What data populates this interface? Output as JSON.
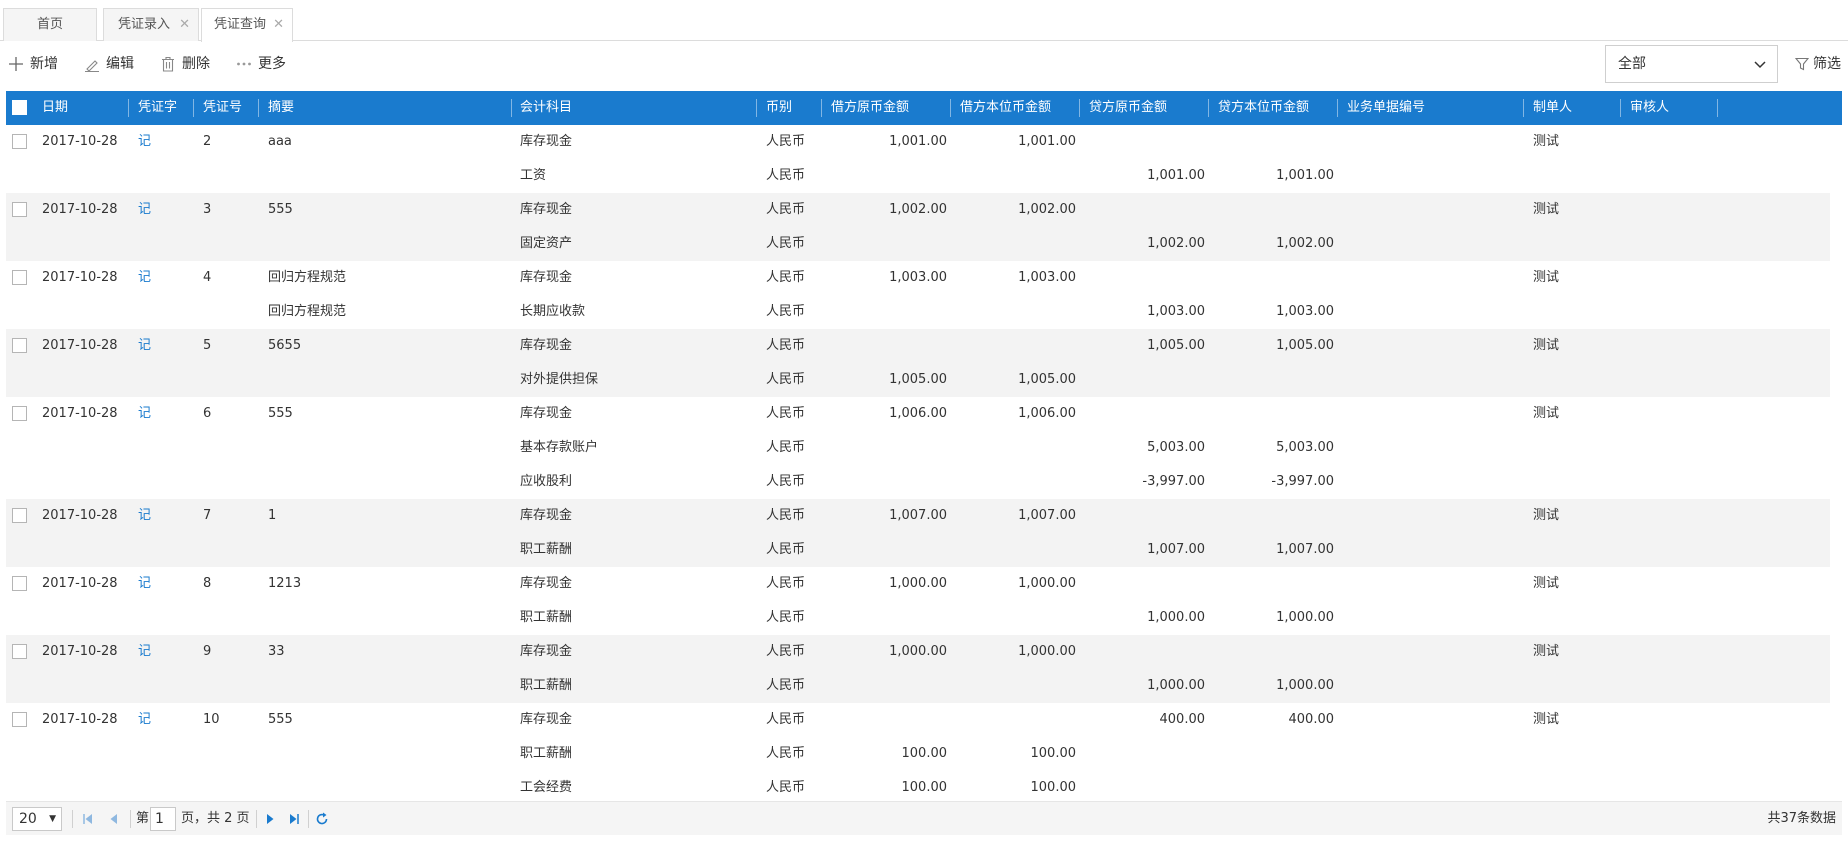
{
  "tabs": [
    {
      "label": "首页",
      "closable": false
    },
    {
      "label": "凭证录入",
      "closable": true
    },
    {
      "label": "凭证查询",
      "closable": true,
      "active": true
    }
  ],
  "toolbar": {
    "add_label": "新增",
    "edit_label": "编辑",
    "delete_label": "删除",
    "more_label": "更多",
    "filter_select_value": "全部",
    "filter_label": "筛选"
  },
  "table": {
    "headers": {
      "date": "日期",
      "voucher_word": "凭证字",
      "voucher_no": "凭证号",
      "summary": "摘要",
      "account": "会计科目",
      "currency": "币别",
      "debit_orig": "借方原币金额",
      "debit_local": "借方本位币金额",
      "credit_orig": "贷方原币金额",
      "credit_local": "贷方本位币金额",
      "biz_no": "业务单据编号",
      "maker": "制单人",
      "reviewer": "审核人"
    },
    "vouchers": [
      {
        "date": "2017-10-28",
        "word": "记",
        "no": "2",
        "maker": "测试",
        "entries": [
          {
            "summary": "aaa",
            "account": "库存现金",
            "currency": "人民币",
            "debit_orig": "1,001.00",
            "debit_local": "1,001.00",
            "credit_orig": "",
            "credit_local": ""
          },
          {
            "summary": "",
            "account": "工资",
            "currency": "人民币",
            "debit_orig": "",
            "debit_local": "",
            "credit_orig": "1,001.00",
            "credit_local": "1,001.00"
          }
        ]
      },
      {
        "date": "2017-10-28",
        "word": "记",
        "no": "3",
        "maker": "测试",
        "entries": [
          {
            "summary": "555",
            "account": "库存现金",
            "currency": "人民币",
            "debit_orig": "1,002.00",
            "debit_local": "1,002.00",
            "credit_orig": "",
            "credit_local": ""
          },
          {
            "summary": "",
            "account": "固定资产",
            "currency": "人民币",
            "debit_orig": "",
            "debit_local": "",
            "credit_orig": "1,002.00",
            "credit_local": "1,002.00"
          }
        ]
      },
      {
        "date": "2017-10-28",
        "word": "记",
        "no": "4",
        "maker": "测试",
        "entries": [
          {
            "summary": "回归方程规范",
            "account": "库存现金",
            "currency": "人民币",
            "debit_orig": "1,003.00",
            "debit_local": "1,003.00",
            "credit_orig": "",
            "credit_local": ""
          },
          {
            "summary": "回归方程规范",
            "account": "长期应收款",
            "currency": "人民币",
            "debit_orig": "",
            "debit_local": "",
            "credit_orig": "1,003.00",
            "credit_local": "1,003.00"
          }
        ]
      },
      {
        "date": "2017-10-28",
        "word": "记",
        "no": "5",
        "maker": "测试",
        "entries": [
          {
            "summary": "5655",
            "account": "库存现金",
            "currency": "人民币",
            "debit_orig": "",
            "debit_local": "",
            "credit_orig": "1,005.00",
            "credit_local": "1,005.00"
          },
          {
            "summary": "",
            "account": "对外提供担保",
            "currency": "人民币",
            "debit_orig": "1,005.00",
            "debit_local": "1,005.00",
            "credit_orig": "",
            "credit_local": ""
          }
        ]
      },
      {
        "date": "2017-10-28",
        "word": "记",
        "no": "6",
        "maker": "测试",
        "entries": [
          {
            "summary": "555",
            "account": "库存现金",
            "currency": "人民币",
            "debit_orig": "1,006.00",
            "debit_local": "1,006.00",
            "credit_orig": "",
            "credit_local": ""
          },
          {
            "summary": "",
            "account": "基本存款账户",
            "currency": "人民币",
            "debit_orig": "",
            "debit_local": "",
            "credit_orig": "5,003.00",
            "credit_local": "5,003.00"
          },
          {
            "summary": "",
            "account": "应收股利",
            "currency": "人民币",
            "debit_orig": "",
            "debit_local": "",
            "credit_orig": "-3,997.00",
            "credit_local": "-3,997.00"
          }
        ]
      },
      {
        "date": "2017-10-28",
        "word": "记",
        "no": "7",
        "maker": "测试",
        "entries": [
          {
            "summary": "1",
            "account": "库存现金",
            "currency": "人民币",
            "debit_orig": "1,007.00",
            "debit_local": "1,007.00",
            "credit_orig": "",
            "credit_local": ""
          },
          {
            "summary": "",
            "account": "职工薪酬",
            "currency": "人民币",
            "debit_orig": "",
            "debit_local": "",
            "credit_orig": "1,007.00",
            "credit_local": "1,007.00"
          }
        ]
      },
      {
        "date": "2017-10-28",
        "word": "记",
        "no": "8",
        "maker": "测试",
        "entries": [
          {
            "summary": "1213",
            "account": "库存现金",
            "currency": "人民币",
            "debit_orig": "1,000.00",
            "debit_local": "1,000.00",
            "credit_orig": "",
            "credit_local": ""
          },
          {
            "summary": "",
            "account": "职工薪酬",
            "currency": "人民币",
            "debit_orig": "",
            "debit_local": "",
            "credit_orig": "1,000.00",
            "credit_local": "1,000.00"
          }
        ]
      },
      {
        "date": "2017-10-28",
        "word": "记",
        "no": "9",
        "maker": "测试",
        "entries": [
          {
            "summary": "33",
            "account": "库存现金",
            "currency": "人民币",
            "debit_orig": "1,000.00",
            "debit_local": "1,000.00",
            "credit_orig": "",
            "credit_local": ""
          },
          {
            "summary": "",
            "account": "职工薪酬",
            "currency": "人民币",
            "debit_orig": "",
            "debit_local": "",
            "credit_orig": "1,000.00",
            "credit_local": "1,000.00"
          }
        ]
      },
      {
        "date": "2017-10-28",
        "word": "记",
        "no": "10",
        "maker": "测试",
        "entries": [
          {
            "summary": "555",
            "account": "库存现金",
            "currency": "人民币",
            "debit_orig": "",
            "debit_local": "",
            "credit_orig": "400.00",
            "credit_local": "400.00"
          },
          {
            "summary": "",
            "account": "职工薪酬",
            "currency": "人民币",
            "debit_orig": "100.00",
            "debit_local": "100.00",
            "credit_orig": "",
            "credit_local": ""
          },
          {
            "summary": "",
            "account": "工会经费",
            "currency": "人民币",
            "debit_orig": "100.00",
            "debit_local": "100.00",
            "credit_orig": "",
            "credit_local": ""
          }
        ]
      }
    ]
  },
  "pager": {
    "page_size": "20",
    "page_prefix": "第",
    "current_page": "1",
    "page_suffix": "页，共 2 页",
    "total_text": "共37条数据"
  },
  "colors": {
    "header_bg": "#1a7bce",
    "link": "#1a7bce",
    "alt_row": "#f3f3f3"
  }
}
